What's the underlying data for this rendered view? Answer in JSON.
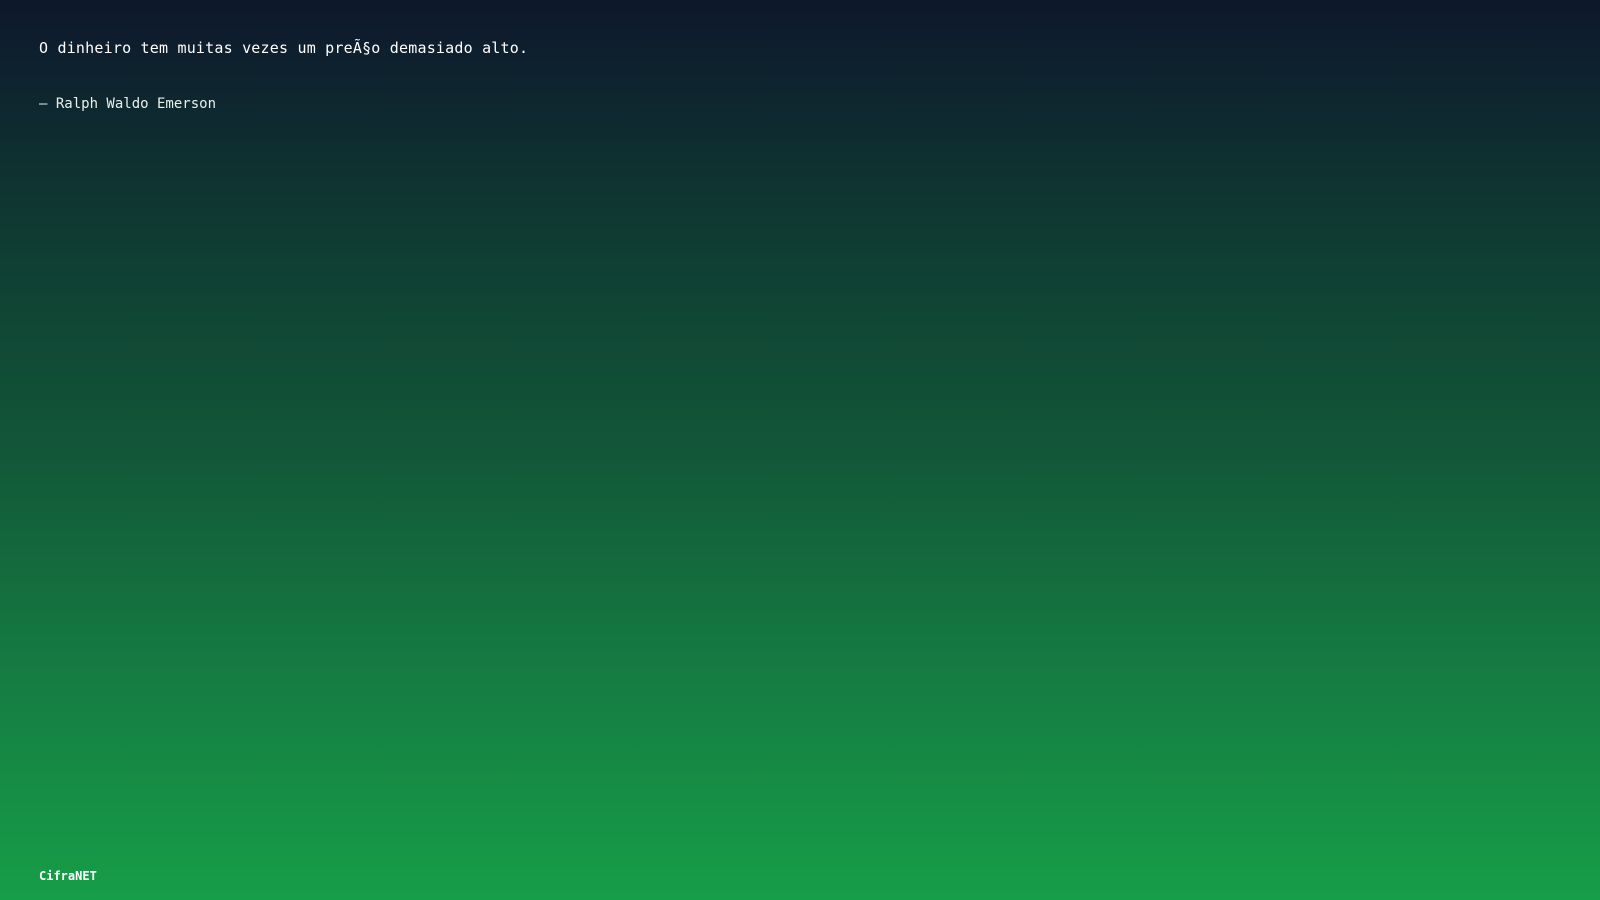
{
  "quote": {
    "text": "O dinheiro tem muitas vezes um preÃ§o demasiado alto.",
    "author": "– Ralph Waldo Emerson"
  },
  "brand": {
    "name": "CifraNET"
  },
  "colors": {
    "gradient_top": "#0e172c",
    "gradient_bottom": "#169e48",
    "text": "#ffffff"
  }
}
